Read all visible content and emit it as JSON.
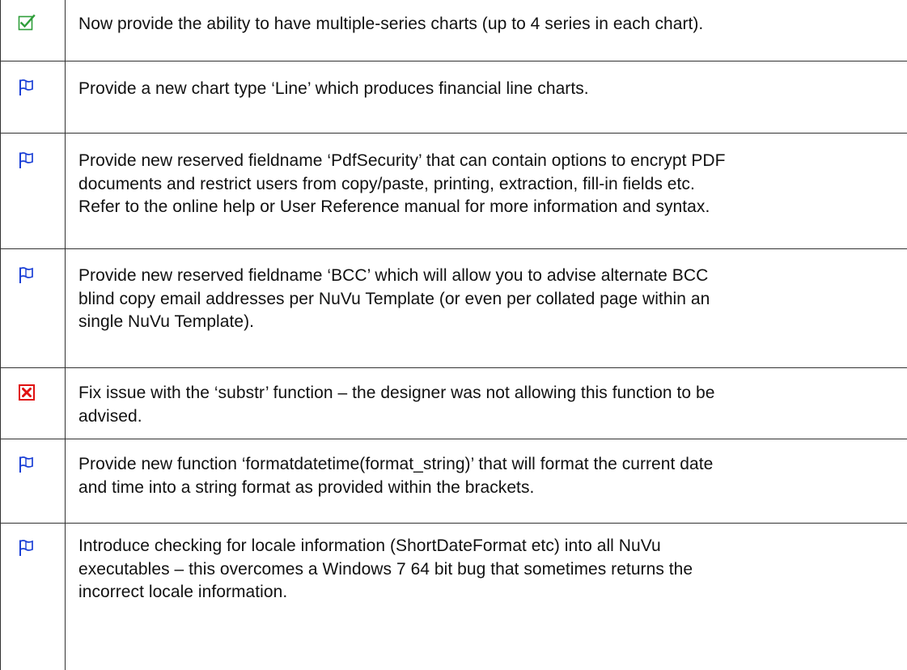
{
  "items": [
    {
      "status": "done",
      "icon": "checkbox-checked-icon",
      "lines": [
        "Now provide the ability to have multiple-series charts (up to 4 series in each chart)."
      ]
    },
    {
      "status": "new",
      "icon": "flag-icon",
      "lines": [
        "Provide a new chart type ‘Line’ which produces financial line charts."
      ]
    },
    {
      "status": "new",
      "icon": "flag-icon",
      "lines": [
        "Provide new reserved fieldname ‘PdfSecurity’ that can contain options to encrypt PDF",
        "documents and restrict users from copy/paste, printing, extraction, fill-in fields etc.",
        "Refer to the online help or User Reference manual for more information and syntax."
      ]
    },
    {
      "status": "new",
      "icon": "flag-icon",
      "lines": [
        "Provide new reserved fieldname ‘BCC’ which will allow you to advise alternate BCC",
        "blind copy email addresses per NuVu Template (or even per collated page within an",
        "single NuVu Template)."
      ]
    },
    {
      "status": "fix",
      "icon": "error-x-icon",
      "lines": [
        "Fix issue with the ‘substr’ function – the designer was not allowing this function to be",
        "advised."
      ]
    },
    {
      "status": "new",
      "icon": "flag-icon",
      "lines": [
        "Provide new function ‘formatdatetime(format_string)’ that will format the current date",
        "and time into a string format as provided within the brackets."
      ]
    },
    {
      "status": "new",
      "icon": "flag-icon",
      "lines": [
        "Introduce checking for locale information (ShortDateFormat etc) into all NuVu",
        "executables – this overcomes a Windows 7 64 bit bug that sometimes returns the",
        "incorrect locale information."
      ]
    }
  ],
  "colors": {
    "check_green": "#2f9e3a",
    "flag_blue": "#1a3fd6",
    "error_red": "#e01010",
    "border": "#333333"
  }
}
